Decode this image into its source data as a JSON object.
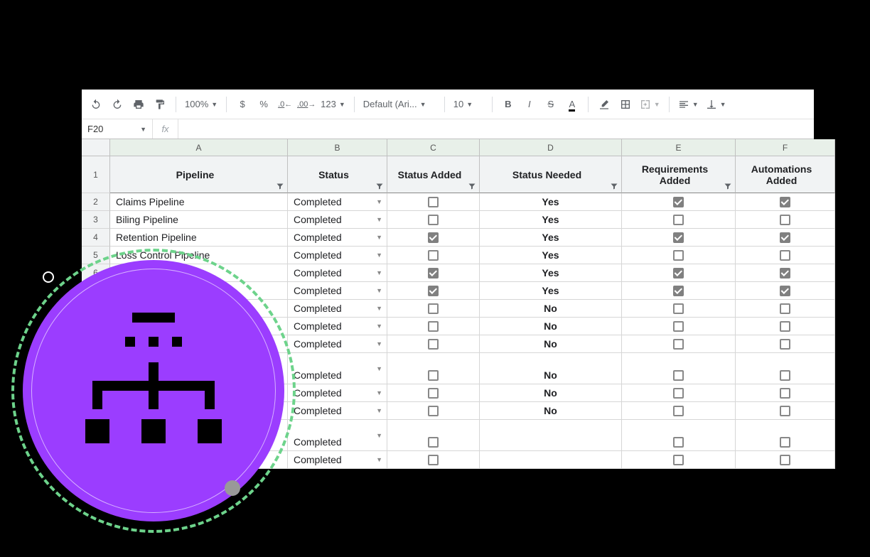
{
  "toolbar": {
    "zoom": "100%",
    "currency": "$",
    "percent": "%",
    "dec_minus": ".0",
    "dec_plus": ".00",
    "fmt123": "123",
    "font": "Default (Ari...",
    "font_size": "10",
    "bold": "B",
    "italic": "I",
    "strike": "S",
    "color_A": "A"
  },
  "formula_bar": {
    "cell_ref": "F20",
    "fx_label": "fx",
    "value": ""
  },
  "columns": [
    "",
    "A",
    "B",
    "C",
    "D",
    "E",
    "F"
  ],
  "headers": {
    "row_num": "1",
    "A": "Pipeline",
    "B": "Status",
    "C": "Status Added",
    "D": "Status Needed",
    "E": "Requirements Added",
    "F": "Automations Added"
  },
  "rows": [
    {
      "num": "2",
      "pipeline": "Claims Pipeline",
      "status": "Completed",
      "status_added": false,
      "status_needed": "Yes",
      "req_added": true,
      "auto_added": true
    },
    {
      "num": "3",
      "pipeline": "Biling Pipeline",
      "status": "Completed",
      "status_added": false,
      "status_needed": "Yes",
      "req_added": false,
      "auto_added": false
    },
    {
      "num": "4",
      "pipeline": "Retention Pipeline",
      "status": "Completed",
      "status_added": true,
      "status_needed": "Yes",
      "req_added": true,
      "auto_added": true
    },
    {
      "num": "5",
      "pipeline": "Loss Control Pipeline",
      "status": "Completed",
      "status_added": false,
      "status_needed": "Yes",
      "req_added": false,
      "auto_added": false
    },
    {
      "num": "6",
      "pipeline": "",
      "status": "Completed",
      "status_added": true,
      "status_needed": "Yes",
      "req_added": true,
      "auto_added": true
    },
    {
      "num": "",
      "pipeline": "",
      "status": "Completed",
      "status_added": true,
      "status_needed": "Yes",
      "req_added": true,
      "auto_added": true
    },
    {
      "num": "",
      "pipeline": "",
      "status": "Completed",
      "status_added": false,
      "status_needed": "No",
      "req_added": false,
      "auto_added": false
    },
    {
      "num": "",
      "pipeline": "",
      "status": "Completed",
      "status_added": false,
      "status_needed": "No",
      "req_added": false,
      "auto_added": false
    },
    {
      "num": "",
      "pipeline": "",
      "status": "Completed",
      "status_added": false,
      "status_needed": "No",
      "req_added": false,
      "auto_added": false
    },
    {
      "num": "",
      "pipeline": "",
      "status": "Completed",
      "status_added": false,
      "status_needed": "No",
      "req_added": false,
      "auto_added": false,
      "tall": true
    },
    {
      "num": "",
      "pipeline": "",
      "status": "Completed",
      "status_added": false,
      "status_needed": "No",
      "req_added": false,
      "auto_added": false
    },
    {
      "num": "",
      "pipeline": "",
      "status": "Completed",
      "status_added": false,
      "status_needed": "No",
      "req_added": false,
      "auto_added": false
    },
    {
      "num": "",
      "pipeline": "",
      "status": "Completed",
      "status_added": false,
      "status_needed": "",
      "req_added": false,
      "auto_added": false,
      "tall": true
    },
    {
      "num": "",
      "pipeline": "",
      "status": "Completed",
      "status_added": false,
      "status_needed": "",
      "req_added": false,
      "auto_added": false
    }
  ]
}
